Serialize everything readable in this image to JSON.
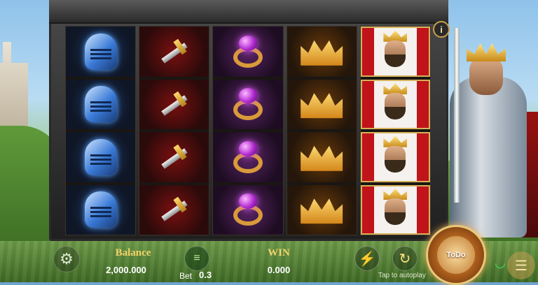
{
  "reels": [
    {
      "symbol": "blue-helmet",
      "rows": 4
    },
    {
      "symbol": "sword",
      "rows": 4
    },
    {
      "symbol": "purple-ring",
      "rows": 4
    },
    {
      "symbol": "gold-crown",
      "rows": 4
    },
    {
      "symbol": "king",
      "rows": 4
    }
  ],
  "info": {
    "label": "i"
  },
  "bottom_bar": {
    "balance_label": "Balance",
    "balance_value": "2,000.000",
    "bet_label": "Bet",
    "bet_value": "0.3",
    "win_label": "WIN",
    "win_value": "0.000",
    "autoplay_hint": "Tap to autoplay",
    "spin_label": "ToDo"
  },
  "icons": {
    "settings": "gear-icon",
    "bet": "coins-icon",
    "turbo": "lightning-icon",
    "autoplay": "autoplay-icon",
    "wifi": "wifi-icon",
    "menu": "menu-icon"
  },
  "colors": {
    "label_gold": "#f5d36a",
    "wifi_green": "#40e060"
  }
}
